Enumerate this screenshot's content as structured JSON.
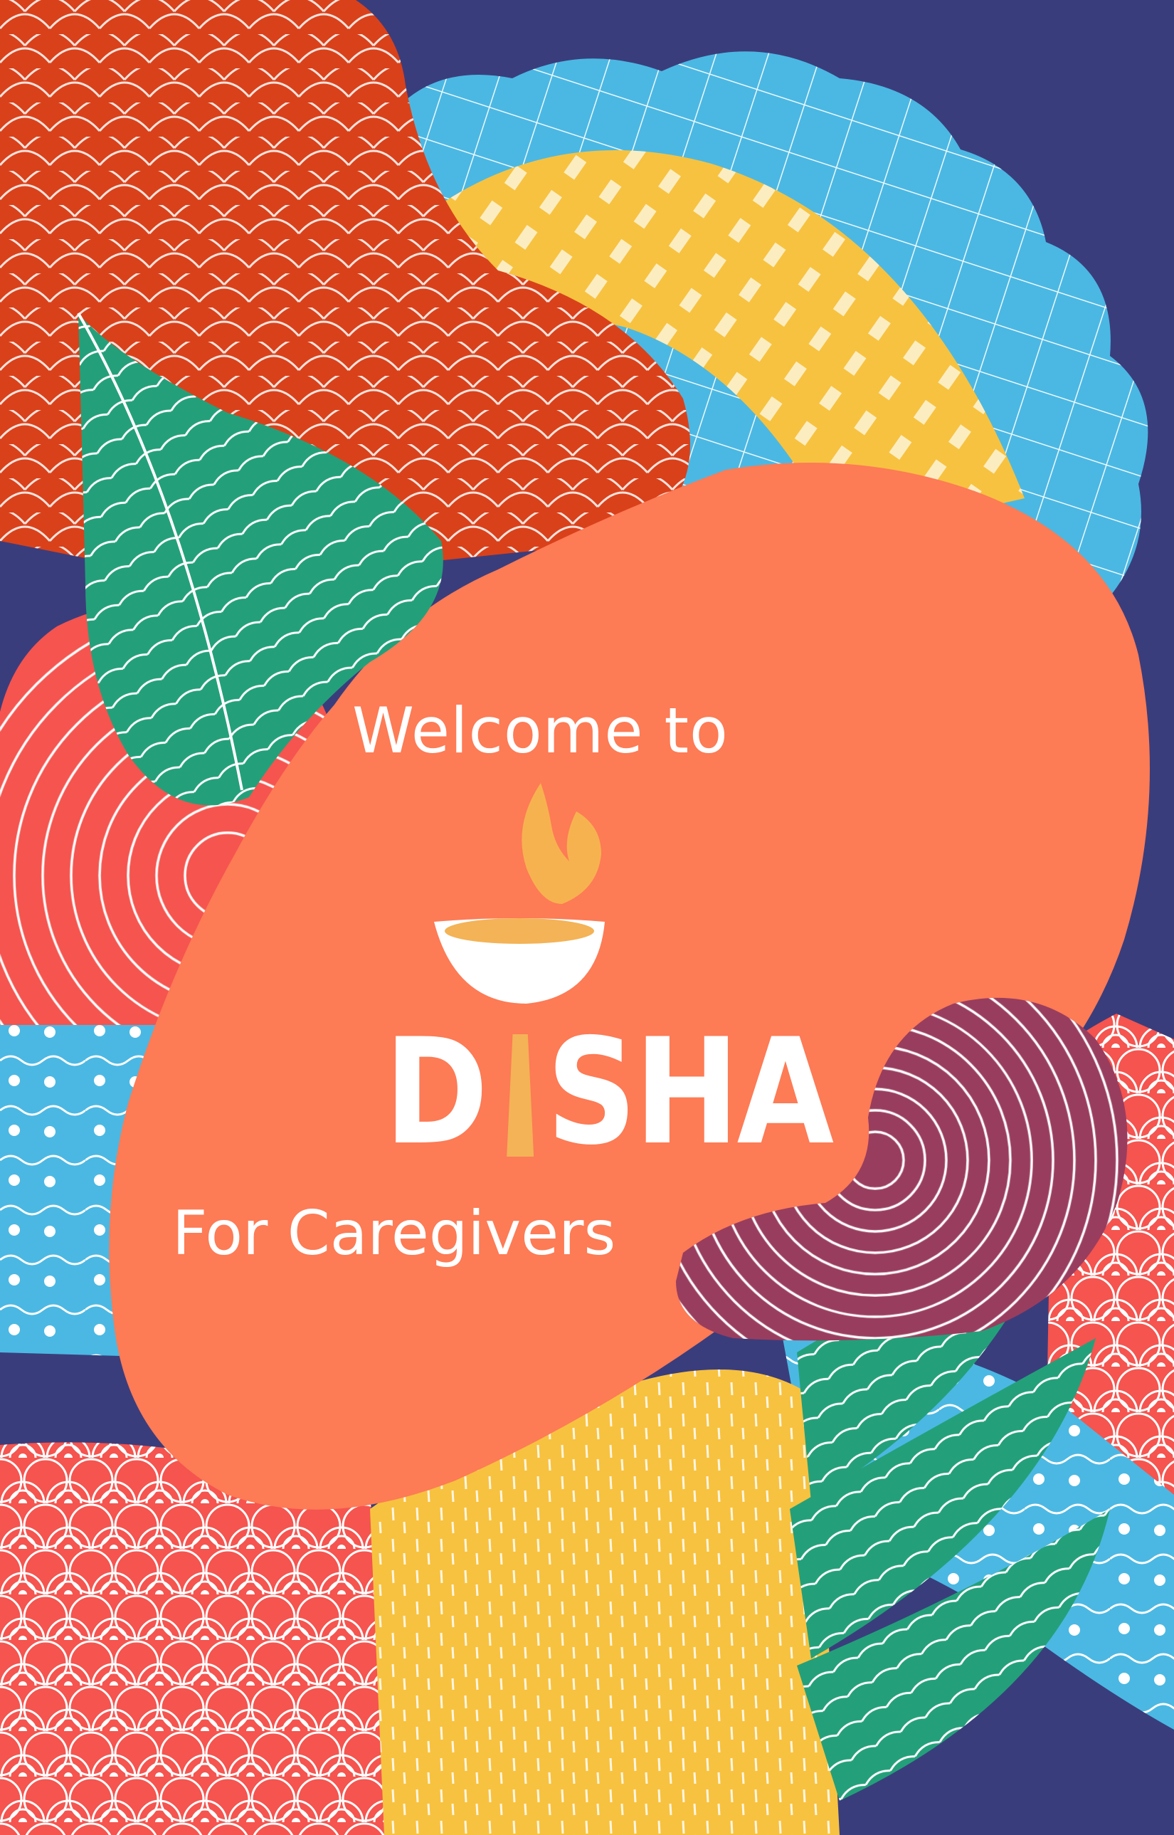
{
  "screen": {
    "welcome_text": "Welcome to",
    "brand": {
      "letter_1": "D",
      "letter_3": "SHA",
      "logo_icon": "diya-lamp-icon",
      "colors": {
        "lamp_flame": "#f7b250",
        "lamp_bowl": "#ffffff",
        "lamp_oil": "#f3b356",
        "i_bar": "#f3b356"
      }
    },
    "subtitle": "For Caregivers"
  },
  "palette": {
    "background": "#3a3d7c",
    "orange_blob": "#fd7b55",
    "rust": "#d9411b",
    "sky_blue": "#4bb8e3",
    "yellow": "#f7c240",
    "green": "#23a07a",
    "coral": "#f5544f",
    "plum": "#993d5e"
  }
}
